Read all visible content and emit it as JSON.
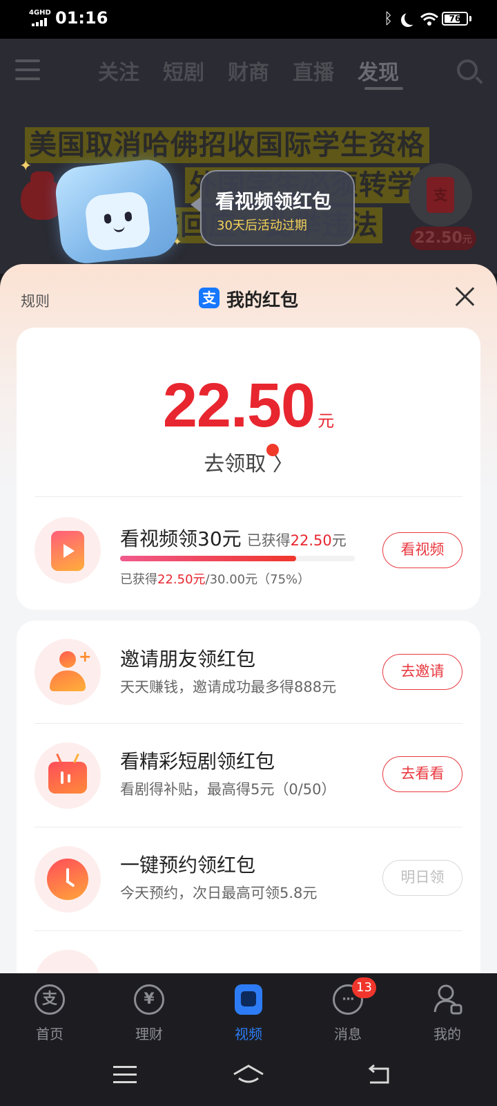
{
  "status_bar": {
    "network": "4GHD",
    "time": "01:16",
    "battery_level": 76,
    "battery_text": "76"
  },
  "background": {
    "nav_tabs": [
      "关注",
      "短剧",
      "财商",
      "直播",
      "发现"
    ],
    "active_tab": "发现",
    "headline_lines": [
      "美国取消哈佛招收国际学生资格",
      "外国学生必须转学",
      "校回应：此举违法"
    ],
    "promo_bubble": {
      "title": "看视频领红包",
      "subtitle": "30天后活动过期"
    },
    "floating_redpacket": {
      "logo_glyph": "支",
      "amount": "22.50",
      "unit": "元"
    }
  },
  "sheet": {
    "rules_label": "规则",
    "logo_glyph": "支",
    "title": "我的红包",
    "amount": "22.50",
    "amount_unit": "元",
    "claim_label": "去领取 〉",
    "claim_dot_color": "#f03a2a",
    "accent_color": "#e8262f"
  },
  "video_task": {
    "title": "看视频领30元",
    "earned_prefix": "已获得",
    "earned_amount": "22.50",
    "earned_unit": "元",
    "progress_fraction": 0.75,
    "detail_prefix": "已获得",
    "detail_amount": "22.50元",
    "detail_suffix": "/30.00元（75%）",
    "button": "看视频"
  },
  "tasks": [
    {
      "icon": "invite-friend-icon",
      "title": "邀请朋友领红包",
      "desc": "天天赚钱，邀请成功最多得888元",
      "button": "去邀请",
      "enabled": true
    },
    {
      "icon": "short-drama-tv-icon",
      "title": "看精彩短剧领红包",
      "desc": "看剧得补贴，最高得5元（0/50）",
      "button": "去看看",
      "enabled": true
    },
    {
      "icon": "clock-icon",
      "title": "一键预约领红包",
      "desc": "今天预约，次日最高可领5.8元",
      "button": "明日领",
      "enabled": false
    }
  ],
  "tabbar": {
    "tabs": [
      {
        "label": "首页",
        "glyph": "支"
      },
      {
        "label": "理财",
        "glyph": "¥"
      },
      {
        "label": "视频",
        "glyph": ""
      },
      {
        "label": "消息",
        "glyph": "···"
      },
      {
        "label": "我的",
        "glyph": ""
      }
    ],
    "active": "视频",
    "message_badge": "13",
    "active_color": "#2d7cf6"
  }
}
